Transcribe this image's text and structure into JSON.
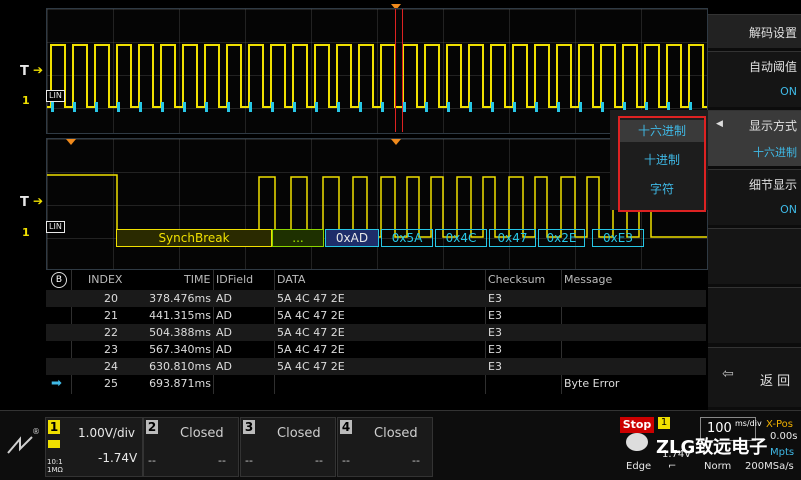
{
  "markers": {
    "trigger_label": "T",
    "channel1_label": "1",
    "lin_tag": "LIN"
  },
  "decode": {
    "synch_break": "SynchBreak",
    "ellipsis": "...",
    "bytes": [
      "0xAD",
      "0x5A",
      "0x4C",
      "0x47",
      "0x2E",
      "0xE3"
    ]
  },
  "menu": {
    "title": "解码设置",
    "items": [
      {
        "label": "自动阈值",
        "value": "ON"
      },
      {
        "label": "显示方式",
        "value": "十六进制"
      },
      {
        "label": "细节显示",
        "value": "ON"
      }
    ],
    "back_label": "返 回"
  },
  "popup": {
    "options": [
      "十六进制",
      "十进制",
      "字符"
    ],
    "selected": "十六进制"
  },
  "table": {
    "headers": {
      "index": "INDEX",
      "time": "TIME",
      "idfield": "IDField",
      "data": "DATA",
      "checksum": "Checksum",
      "message": "Message"
    },
    "rows": [
      {
        "index": "20",
        "time": "378.476ms",
        "idfield": "AD",
        "data": "5A 4C 47 2E",
        "checksum": "E3",
        "message": ""
      },
      {
        "index": "21",
        "time": "441.315ms",
        "idfield": "AD",
        "data": "5A 4C 47 2E",
        "checksum": "E3",
        "message": ""
      },
      {
        "index": "22",
        "time": "504.388ms",
        "idfield": "AD",
        "data": "5A 4C 47 2E",
        "checksum": "E3",
        "message": ""
      },
      {
        "index": "23",
        "time": "567.340ms",
        "idfield": "AD",
        "data": "5A 4C 47 2E",
        "checksum": "E3",
        "message": ""
      },
      {
        "index": "24",
        "time": "630.810ms",
        "idfield": "AD",
        "data": "5A 4C 47 2E",
        "checksum": "E3",
        "message": ""
      },
      {
        "index": "25",
        "time": "693.871ms",
        "idfield": "",
        "data": "",
        "checksum": "",
        "message": "Byte Error"
      }
    ]
  },
  "channels": [
    {
      "num": "1",
      "scale": "1.00V/div",
      "offset": "-1.74V",
      "coupling": "10:1",
      "impedance": "1MΩ",
      "color": "#f0e000"
    },
    {
      "num": "2",
      "state": "Closed",
      "offset_a": "--",
      "offset_b": "--",
      "color": "#bbbbbb"
    },
    {
      "num": "3",
      "state": "Closed",
      "offset_a": "--",
      "offset_b": "--",
      "color": "#bbbbbb"
    },
    {
      "num": "4",
      "state": "Closed",
      "offset_a": "--",
      "offset_b": "--",
      "color": "#bbbbbb"
    }
  ],
  "status": {
    "run_state": "Stop",
    "trigger_level": "1.74V",
    "trigger_mode": "Edge",
    "timebase_value": "100",
    "timebase_unit": "ms/div",
    "acq_mode": "Norm",
    "sample_rate": "200MSa/s",
    "xpos_label": "X-Pos",
    "xpos_value": "0.00s",
    "memory": "Mpts",
    "watermark": "ZLG致远电子"
  },
  "colors": {
    "channel1": "#f0e000",
    "decode_cyan": "#27c7e6",
    "accent_blue": "#3fb9e6",
    "highlight_red": "#d22222",
    "trigger_orange": "#f08a1c"
  }
}
